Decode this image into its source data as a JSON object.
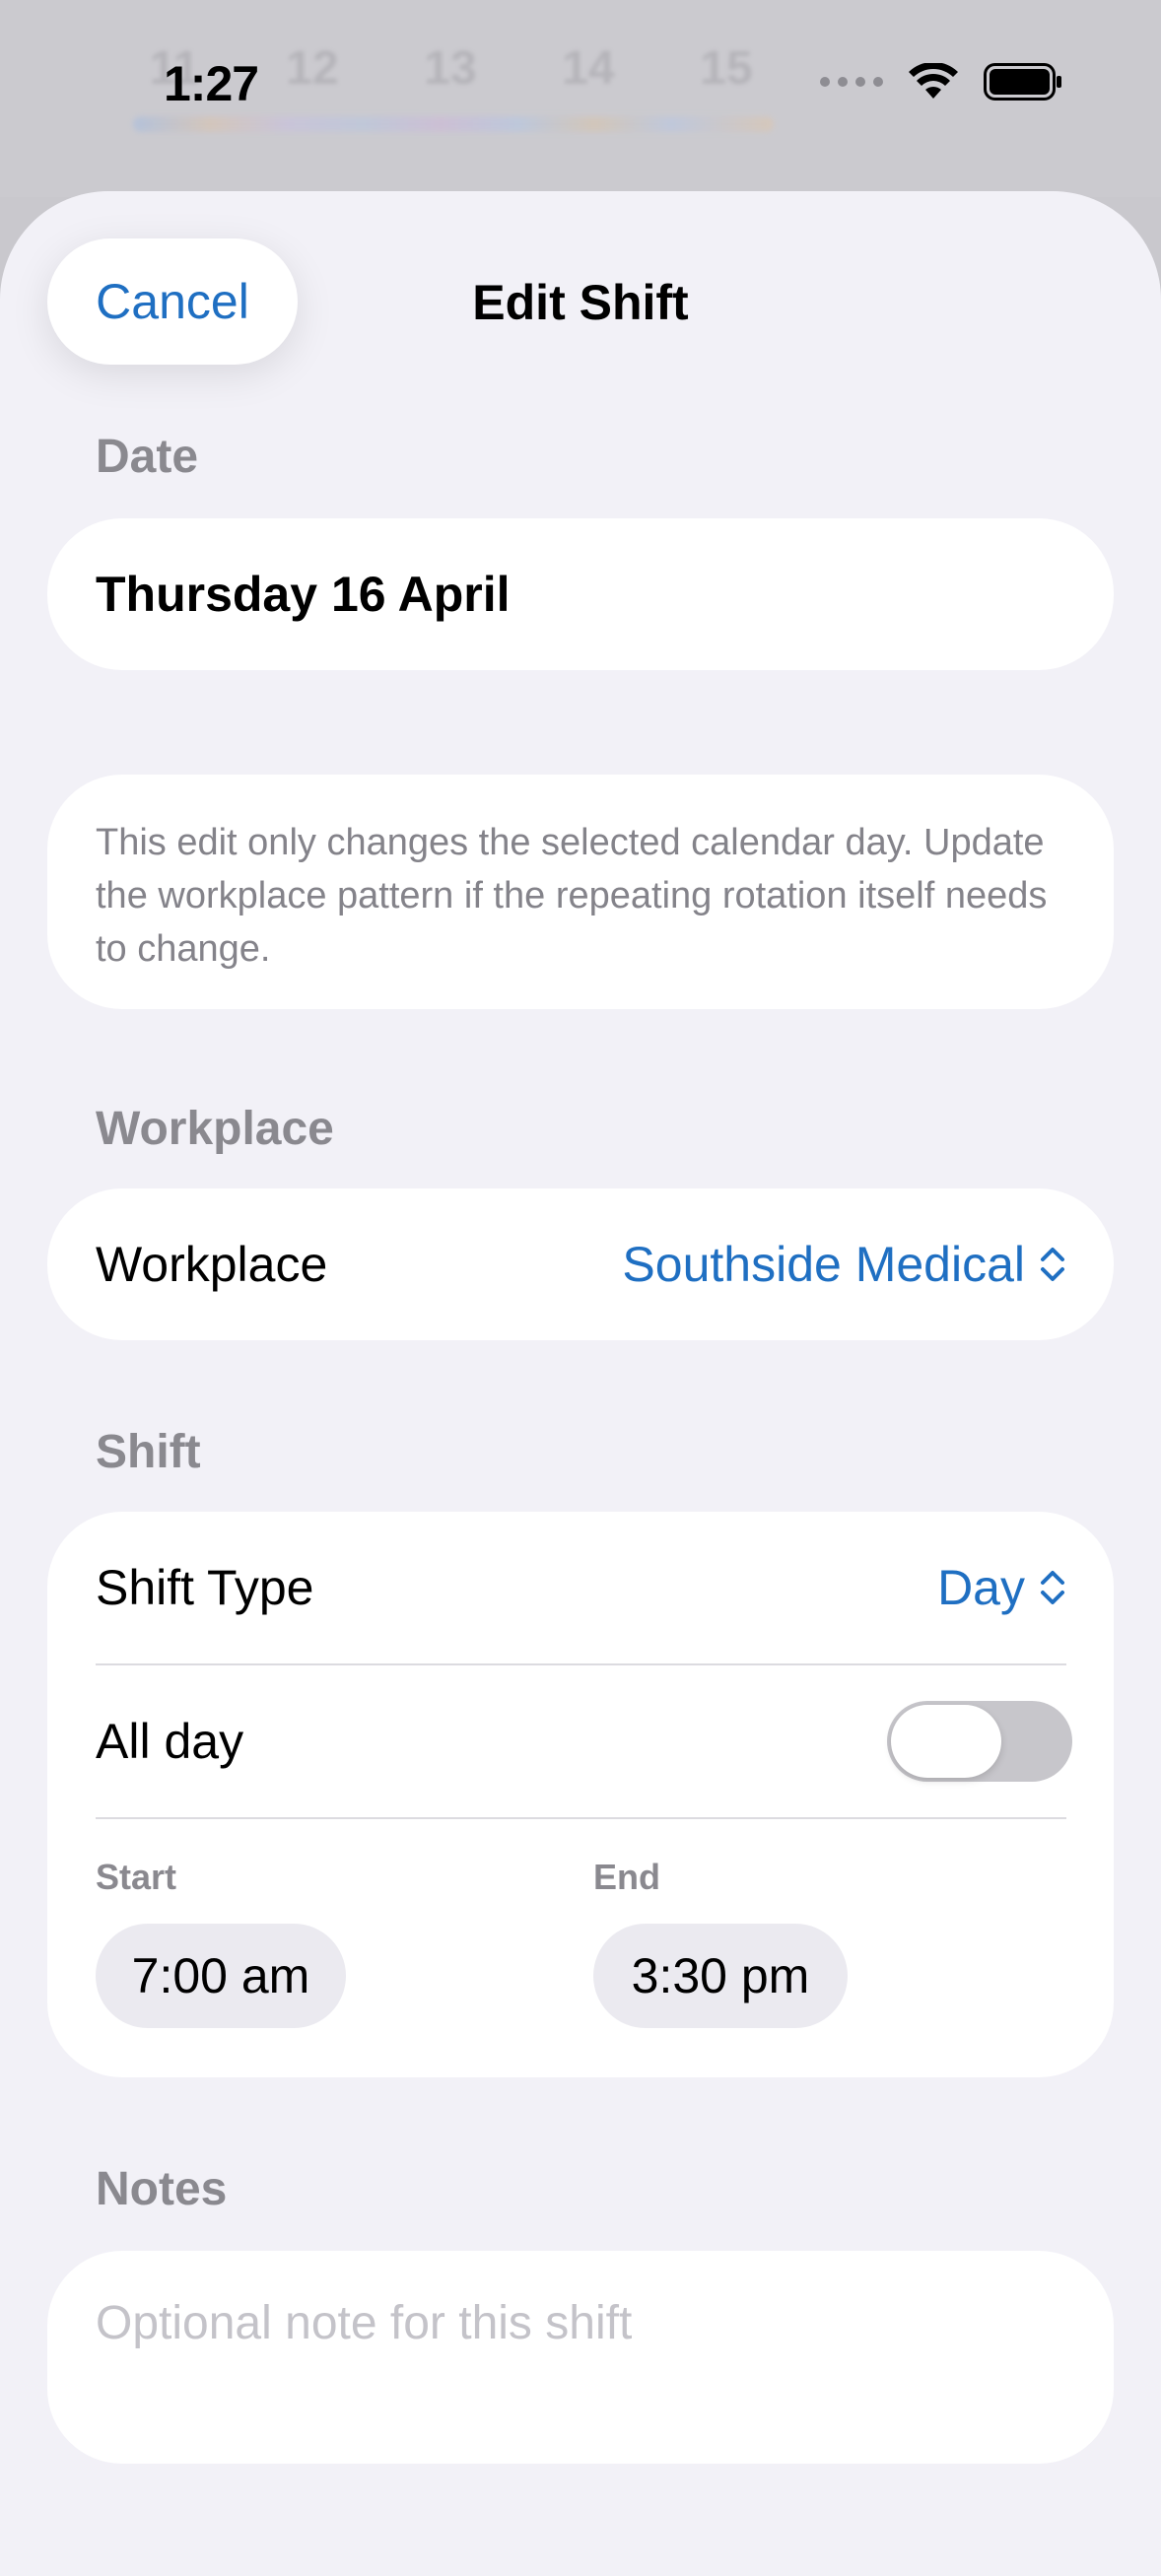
{
  "status_bar": {
    "time": "1:27"
  },
  "background_calendar": {
    "days": [
      "11",
      "12",
      "13",
      "14",
      "15"
    ]
  },
  "header": {
    "cancel_label": "Cancel",
    "title": "Edit Shift"
  },
  "date_section": {
    "label": "Date",
    "value": "Thursday 16 April"
  },
  "info": {
    "text": "This edit only changes the selected calendar day. Update the workplace pattern if the repeating rotation itself needs to change."
  },
  "workplace_section": {
    "label": "Workplace",
    "row_label": "Workplace",
    "value": "Southside Medical"
  },
  "shift_section": {
    "label": "Shift",
    "type_label": "Shift Type",
    "type_value": "Day",
    "all_day_label": "All day",
    "all_day_on": false,
    "start_label": "Start",
    "start_value": "7:00 am",
    "end_label": "End",
    "end_value": "3:30 pm"
  },
  "notes_section": {
    "label": "Notes",
    "placeholder": "Optional note for this shift"
  },
  "colors": {
    "accent": "#1f6fc2",
    "sheet_background": "#f2f1f7",
    "card_background": "#ffffff",
    "secondary_text": "#8a898f"
  },
  "icons": {
    "signal": "cellular-signal-icon",
    "wifi": "wifi-icon",
    "battery": "battery-icon",
    "picker": "chevron-up-down-icon"
  }
}
